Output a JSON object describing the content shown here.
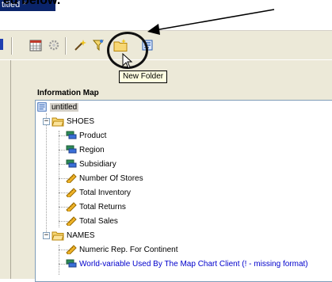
{
  "window": {
    "title": "titled *"
  },
  "caption": {
    "text": "ed below."
  },
  "toolbar": {
    "buttons": [
      {
        "icon": "calendar-grid-icon"
      },
      {
        "icon": "gear-icon"
      },
      {
        "icon": "wand-icon"
      },
      {
        "icon": "filter-icon"
      },
      {
        "icon": "new-folder-icon"
      },
      {
        "icon": "information-map-icon"
      }
    ],
    "tooltip": "New Folder"
  },
  "panel": {
    "title": "Information Map"
  },
  "tree": {
    "root": "untitled",
    "folders": [
      {
        "label": "SHOES",
        "items": [
          {
            "label": "Product",
            "icon": "category-icon"
          },
          {
            "label": "Region",
            "icon": "category-icon"
          },
          {
            "label": "Subsidiary",
            "icon": "category-icon"
          },
          {
            "label": "Number Of Stores",
            "icon": "measure-icon"
          },
          {
            "label": "Total Inventory",
            "icon": "measure-icon"
          },
          {
            "label": "Total Returns",
            "icon": "measure-icon"
          },
          {
            "label": "Total Sales",
            "icon": "measure-icon"
          }
        ]
      },
      {
        "label": "NAMES",
        "items": [
          {
            "label": "Numeric Rep. For Continent",
            "icon": "measure-icon"
          },
          {
            "label": "World-variable Used By The Map Chart Client (! - missing format)",
            "icon": "category-icon"
          }
        ]
      }
    ]
  },
  "colors": {
    "toolbar_bg": "#ece9d8",
    "selection_bg": "#d4d0c8",
    "link_blue": "#0000cc",
    "tooltip_bg": "#ffffe1"
  }
}
